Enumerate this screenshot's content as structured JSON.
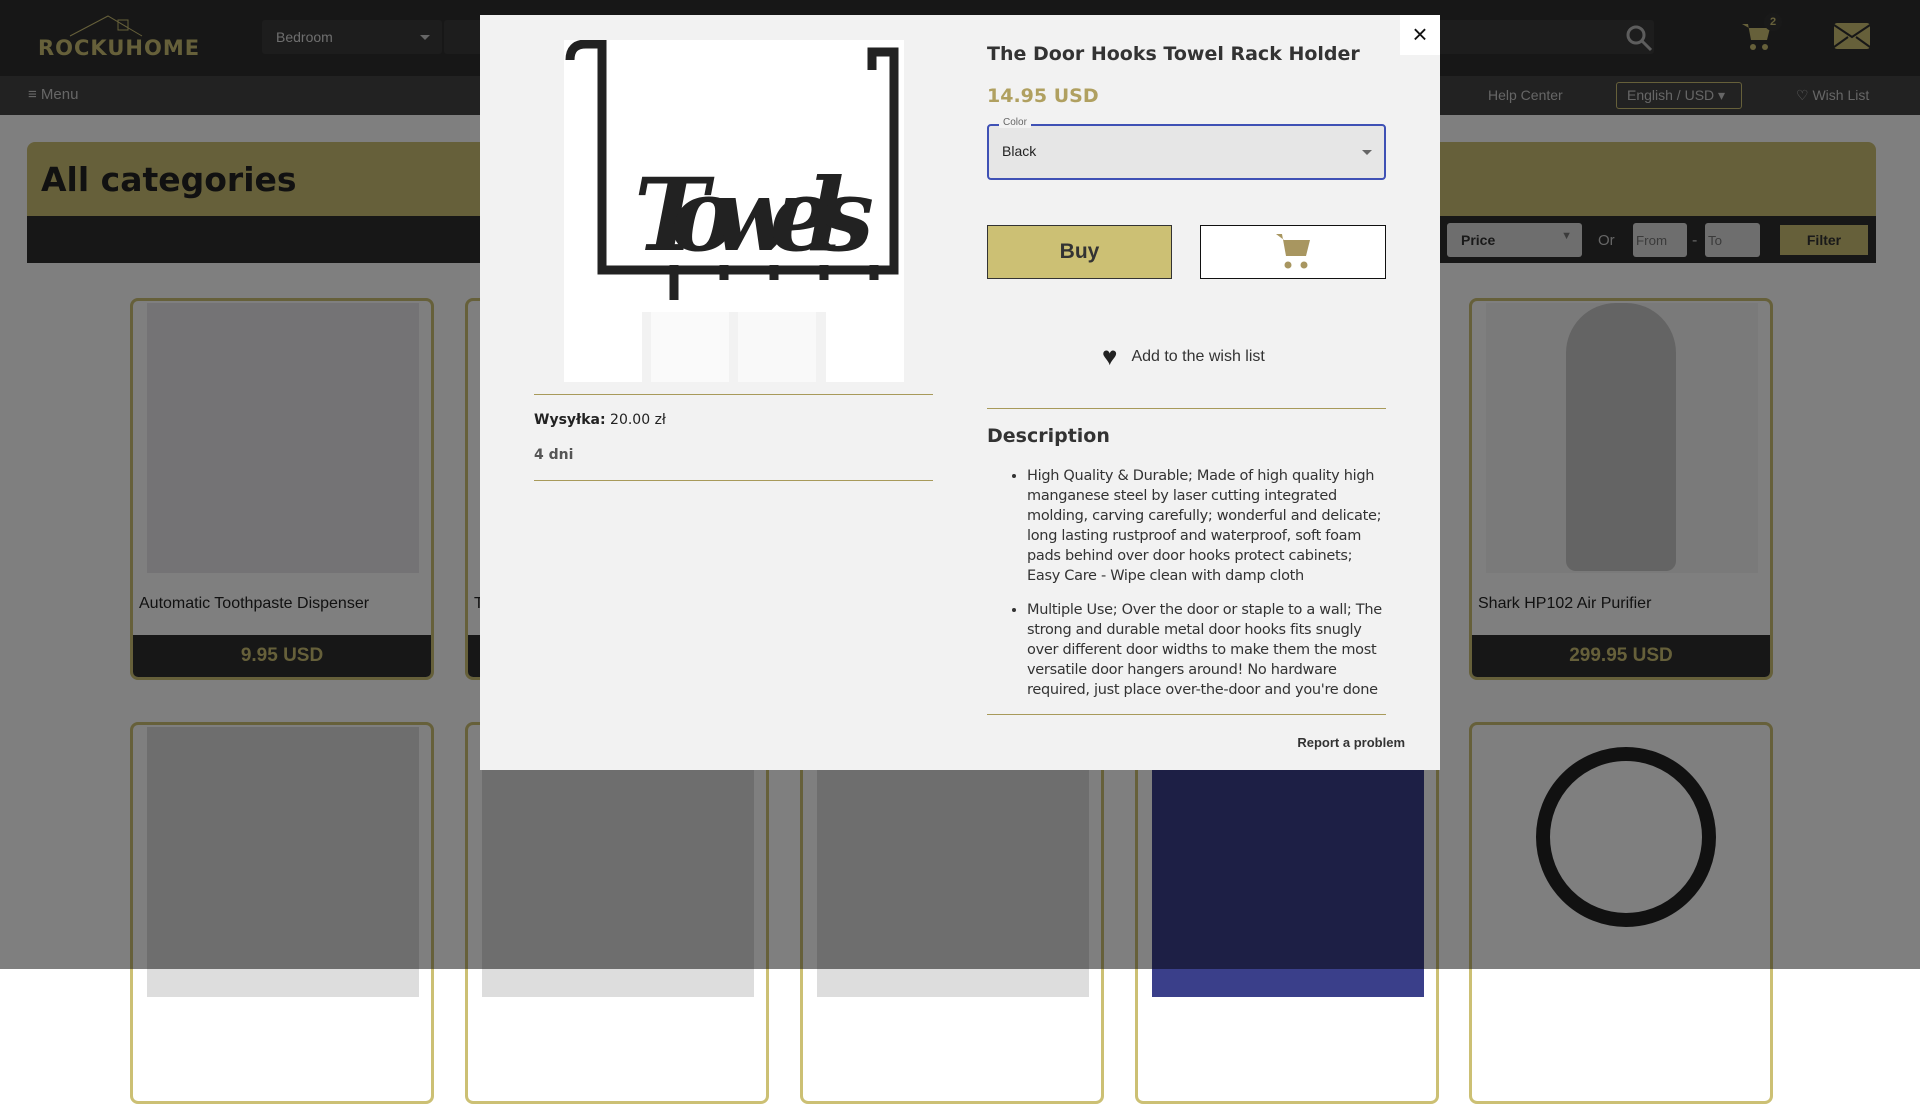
{
  "header": {
    "logo": "ROCKUHOME",
    "category": "Bedroom",
    "cart_count": "2"
  },
  "nav": {
    "menu": "Menu",
    "help": "Help Center",
    "language": "English / USD",
    "wishlist": "♡ Wish List"
  },
  "banner": {
    "title": "All categories"
  },
  "filter": {
    "sort": "Price",
    "or": "Or",
    "from_placeholder": "From",
    "dash": "-",
    "to_placeholder": "To",
    "filter": "Filter"
  },
  "cards": [
    {
      "name": "Automatic Toothpaste Dispenser",
      "price": "9.95 USD"
    },
    {
      "name": "T",
      "price": ""
    },
    {
      "name": "",
      "price": ""
    },
    {
      "name": "",
      "price": ""
    },
    {
      "name": "Shark HP102 Air Purifier",
      "price": "299.95 USD"
    }
  ],
  "modal": {
    "title": "The Door Hooks Towel Rack Holder",
    "price": "14.95 USD",
    "color_label": "Color",
    "color_value": "Black",
    "buy": "Buy",
    "wishlist": "Add to the wish list",
    "shipping_label": "Wysyłka:",
    "shipping_value": " 20.00 zł",
    "delivery": "4 dni",
    "description_title": "Description",
    "description": [
      "High Quality & Durable; Made of high quality high manganese steel by laser cutting integrated molding, carving carefully; wonderful and delicate; long lasting rustproof and waterproof, soft foam pads behind over door hooks protect cabinets; Easy Care - Wipe clean with damp cloth",
      "Multiple Use; Over the door or staple to a wall; The strong and durable metal door hooks fits snugly over different door widths to make them the most versatile door hangers around! No hardware required, just place over-the-door and you're done"
    ],
    "report": "Report a problem",
    "close": "×"
  },
  "colors": {
    "gold": "#ccc074",
    "dark": "#2e2e2e",
    "focus": "#3f51b5"
  }
}
